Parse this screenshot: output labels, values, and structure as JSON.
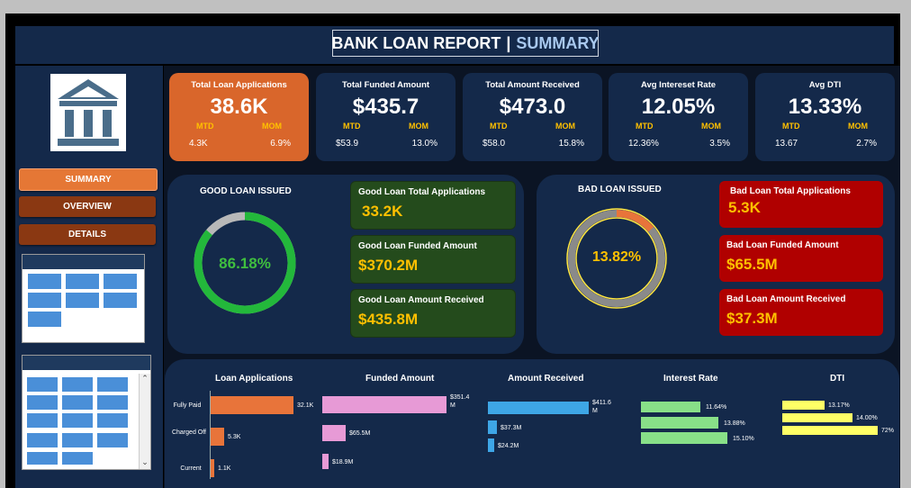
{
  "title": {
    "main": "BANK LOAN REPORT",
    "separator": "|",
    "sub": "SUMMARY"
  },
  "nav": {
    "summary": "SUMMARY",
    "overview": "OVERVIEW",
    "details": "DETAILS"
  },
  "kpis": [
    {
      "label": "Total Loan Applications",
      "value": "38.6K",
      "mtd_label": "MTD",
      "mom_label": "MOM",
      "mtd": "4.3K",
      "mom": "6.9%"
    },
    {
      "label": "Total Funded Amount",
      "value": "$435.7",
      "mtd_label": "MTD",
      "mom_label": "MOM",
      "mtd": "$53.9",
      "mom": "13.0%"
    },
    {
      "label": "Total Amount Received",
      "value": "$473.0",
      "mtd_label": "MTD",
      "mom_label": "MOM",
      "mtd": "$58.0",
      "mom": "15.8%"
    },
    {
      "label": "Avg Intereset Rate",
      "value": "12.05%",
      "mtd_label": "MTD",
      "mom_label": "MOM",
      "mtd": "12.36%",
      "mom": "3.5%"
    },
    {
      "label": "Avg DTI",
      "value": "13.33%",
      "mtd_label": "MTD",
      "mom_label": "MOM",
      "mtd": "13.67",
      "mom": "2.7%"
    }
  ],
  "good": {
    "title": "GOOD LOAN ISSUED",
    "percent": "86.18%",
    "fraction": 0.8618,
    "cards": [
      {
        "label": "Good Loan Total Applications",
        "value": "33.2K"
      },
      {
        "label": "Good Loan Funded Amount",
        "value": "$370.2M"
      },
      {
        "label": "Good Loan Amount Received",
        "value": "$435.8M"
      }
    ]
  },
  "bad": {
    "title": "BAD LOAN ISSUED",
    "percent": "13.82%",
    "fraction": 0.1382,
    "cards": [
      {
        "label": "Bad Loan Total Applications",
        "value": "5.3K"
      },
      {
        "label": "Bad Loan Funded Amount",
        "value": "$65.5M"
      },
      {
        "label": "Bad Loan Amount Received",
        "value": "$37.3M"
      }
    ]
  },
  "status": {
    "headers": [
      "Loan Applications",
      "Funded Amount",
      "Amount Received",
      "Interest Rate",
      "DTI"
    ],
    "rows": [
      "Fully Paid",
      "Charged Off",
      "Current"
    ],
    "applications": {
      "values": [
        32.1,
        5.3,
        1.1
      ],
      "labels": [
        "32.1K",
        "5.3K",
        "1.1K"
      ]
    },
    "funded": {
      "values": [
        351.4,
        65.5,
        18.9
      ],
      "labels": [
        "$351.4 M",
        "$65.5M",
        "$18.9M"
      ]
    },
    "received": {
      "values": [
        411.6,
        37.3,
        24.2
      ],
      "labels": [
        "$411.6 M",
        "$37.3M",
        "$24.2M"
      ]
    },
    "interest": {
      "values": [
        11.64,
        13.88,
        15.1
      ],
      "labels": [
        "11.64%",
        "13.88%",
        "15.10%"
      ]
    },
    "dti": {
      "values": [
        13.17,
        14.0,
        14.72
      ],
      "labels": [
        "13.17%",
        "14.00%",
        "72%"
      ]
    }
  },
  "colors": {
    "applications": "#e8743a",
    "funded": "#e79ad6",
    "received": "#3ea6e6",
    "interest": "#88e088",
    "dti": "#ffff66",
    "good_ring": "#23b83b",
    "bad_ring": "#8a8a8a",
    "accent": "#ffc000"
  }
}
